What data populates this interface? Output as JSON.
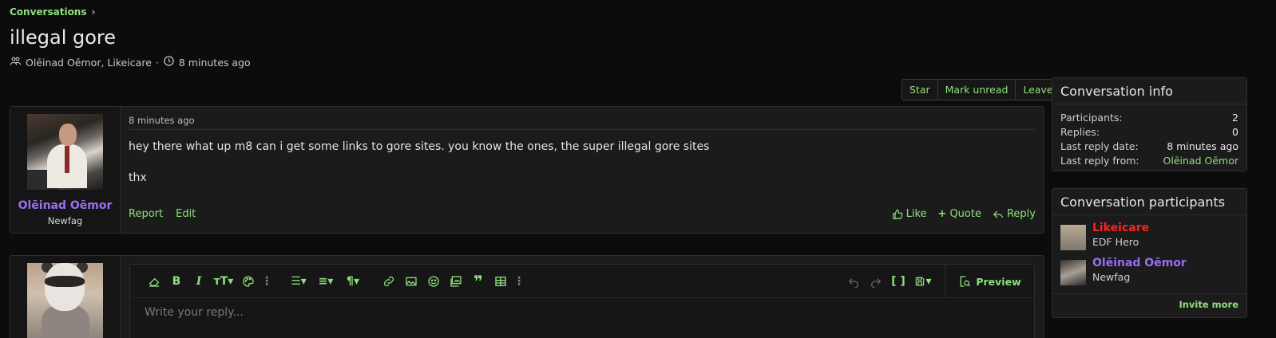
{
  "breadcrumb": {
    "label": "Conversations",
    "chevron": "chevron-right-icon"
  },
  "page": {
    "title": "illegal gore",
    "participants_text": "Olēinad Oēmor, Likeicare",
    "separator": "·",
    "time_ago": "8 minutes ago"
  },
  "actions": {
    "star": "Star",
    "mark_unread": "Mark unread",
    "leave": "Leave"
  },
  "message": {
    "username": "Olēinad Oēmor",
    "user_title": "Newfag",
    "time": "8 minutes ago",
    "line1": "hey there what up m8 can i get some links to gore sites. you know the ones, the super illegal gore sites",
    "line2": "thx",
    "report": "Report",
    "edit": "Edit",
    "like": "Like",
    "quote": "Quote",
    "reply": "Reply"
  },
  "reply_editor": {
    "placeholder": "Write your reply...",
    "preview": "Preview"
  },
  "conversation_info": {
    "title": "Conversation info",
    "rows": [
      {
        "label": "Participants:",
        "value": "2"
      },
      {
        "label": "Replies:",
        "value": "0"
      },
      {
        "label": "Last reply date:",
        "value": "8 minutes ago"
      },
      {
        "label": "Last reply from:",
        "value": "Olēinad Oēmor"
      }
    ]
  },
  "conversation_participants": {
    "title": "Conversation participants",
    "people": [
      {
        "name": "Likeicare",
        "role": "EDF Hero",
        "color": "#ff2020"
      },
      {
        "name": "Olēinad Oēmor",
        "role": "Newfag",
        "color": "#9b6df2"
      }
    ],
    "invite": "Invite more"
  },
  "colors": {
    "accent": "#8ee07d",
    "background": "#0c0c0c",
    "panel": "#1b1b1b"
  }
}
